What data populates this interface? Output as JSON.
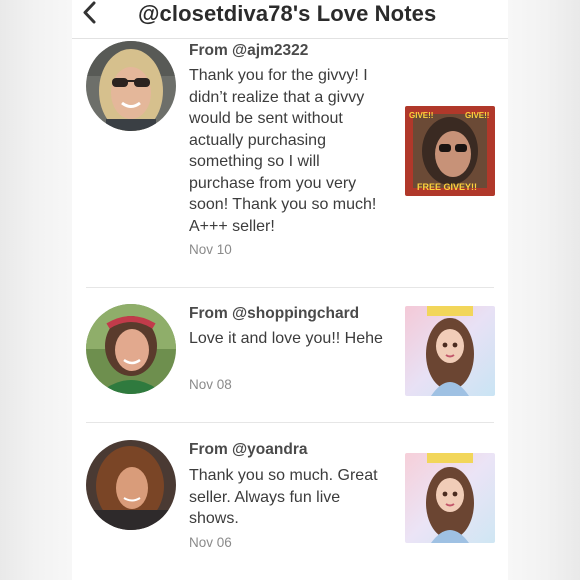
{
  "header": {
    "title": "@closetdiva78's Love Notes"
  },
  "notes": [
    {
      "from": "From @ajm2322",
      "message": "Thank you for the givvy! I didn’t realize that a givvy would be sent without actually purchasing something so I will purchase from you very soon! Thank you so much! A+++ seller!",
      "date": "Nov 10",
      "thumb_text_left": "GIVE!!",
      "thumb_text_right": "GIVE!!",
      "thumb_caption": "FREE   GIVEY!!"
    },
    {
      "from": "From @shoppingchard",
      "message": "Love it and love you!! Hehe",
      "date": "Nov 08"
    },
    {
      "from": "From @yoandra",
      "message": "Thank you so much. Great seller. Always fun live shows.",
      "date": "Nov 06"
    }
  ],
  "colors": {
    "title": "#2b2b2b",
    "text": "#3c3c3c",
    "date": "#8a8a8a",
    "divider": "#e6e6e6"
  }
}
